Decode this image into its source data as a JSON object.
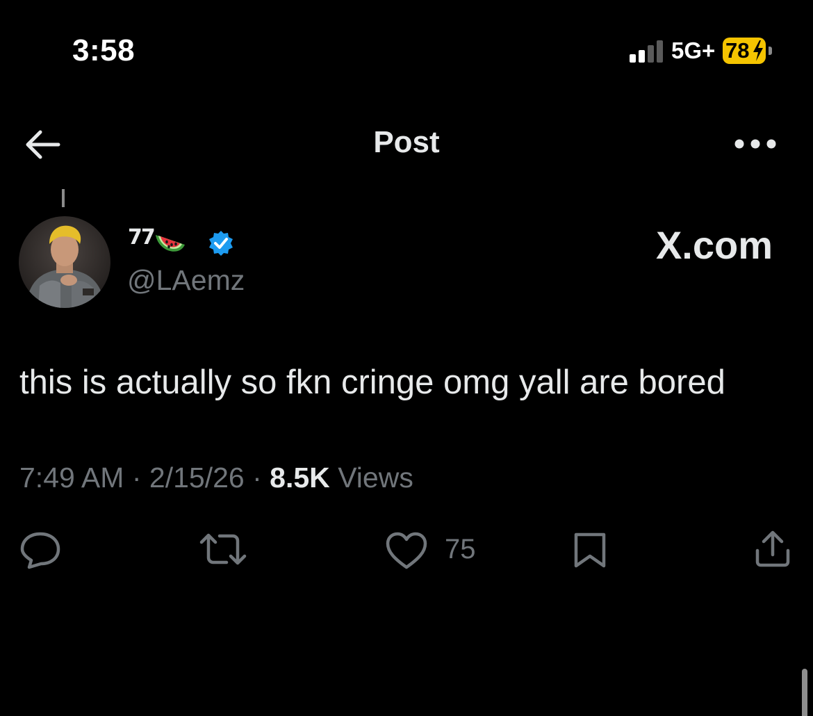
{
  "status_bar": {
    "time": "3:58",
    "network": "5G+",
    "battery_percent": "78",
    "battery_color": "#f5c400"
  },
  "header": {
    "title": "Post",
    "back_icon": "arrow-left-icon",
    "more_icon": "more-horizontal-icon"
  },
  "post": {
    "author": {
      "display_name": "77",
      "name_emoji": "watermelon-icon",
      "verified": true,
      "handle": "@LAemz"
    },
    "source_label": "X.com",
    "text": "this is actually so fkn cringe omg yall are bored",
    "time": "7:49 AM",
    "date": "2/15/26",
    "views_count": "8.5K",
    "views_label": "Views",
    "separator": "·",
    "actions": {
      "reply_icon": "reply-icon",
      "repost_icon": "repost-icon",
      "like_icon": "heart-icon",
      "like_count": "75",
      "bookmark_icon": "bookmark-icon",
      "share_icon": "share-icon"
    }
  },
  "colors": {
    "background": "#000000",
    "text_primary": "#e7e9ea",
    "text_secondary": "#71767b",
    "verified_blue": "#1d9bf0"
  }
}
